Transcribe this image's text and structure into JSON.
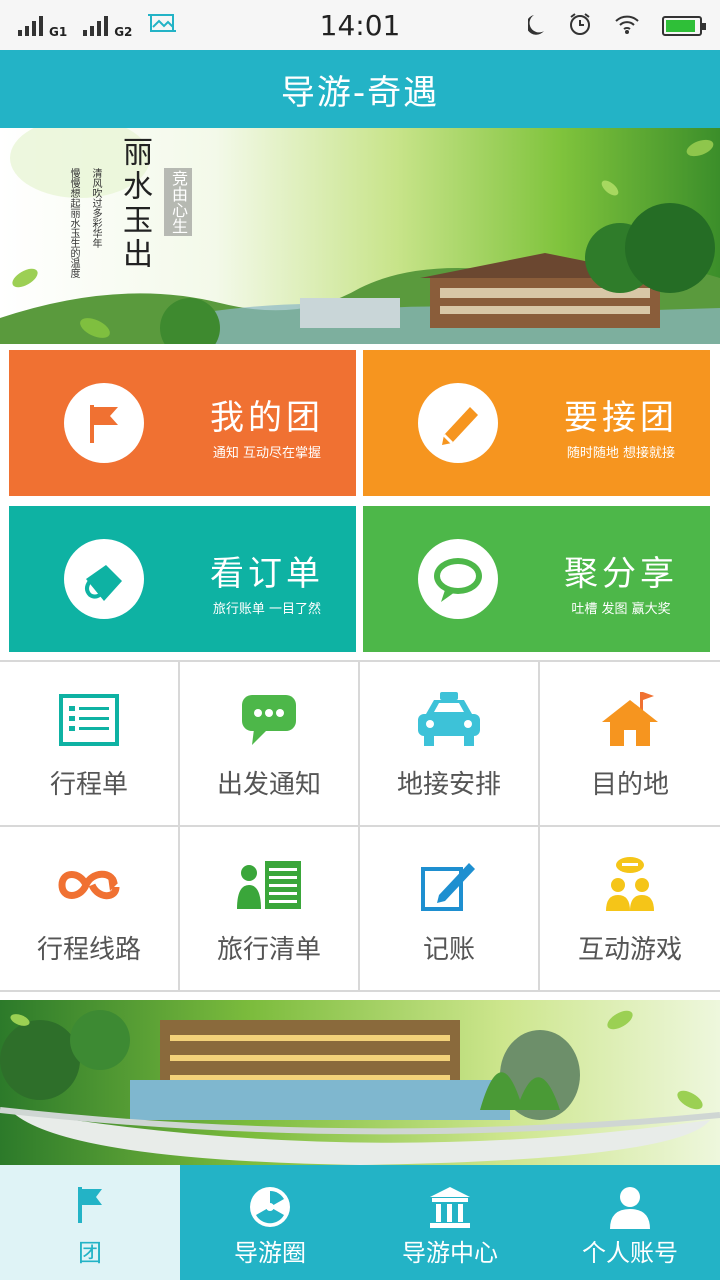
{
  "status_bar": {
    "sim1_label": "G1",
    "sim2_label": "G2",
    "time": "14:01"
  },
  "header": {
    "title": "导游-奇遇"
  },
  "banner_top": {
    "title": "丽水玉出",
    "tagline": "清风吹过多彩华年",
    "subline": "慢慢想起丽水玉生的温度",
    "stamp": "竞由心生"
  },
  "tiles": [
    {
      "title": "我的团",
      "subtitle": "通知 互动尽在掌握",
      "icon": "flag-icon",
      "color": "#f07132"
    },
    {
      "title": "要接团",
      "subtitle": "随时随地 想接就接",
      "icon": "pencil-icon",
      "color": "#f6951f"
    },
    {
      "title": "看订单",
      "subtitle": "旅行账单  一目了然",
      "icon": "clip-icon",
      "color": "#0eb2a3"
    },
    {
      "title": "聚分享",
      "subtitle": "吐槽 发图 赢大奖",
      "icon": "speech-bubble-icon",
      "color": "#4db749"
    }
  ],
  "grid": [
    {
      "label": "行程单",
      "icon": "itinerary-list-icon",
      "color": "#0eb2a3"
    },
    {
      "label": "出发通知",
      "icon": "chat-bubble-icon",
      "color": "#4db749"
    },
    {
      "label": "地接安排",
      "icon": "taxi-icon",
      "color": "#3dc2d8"
    },
    {
      "label": "目的地",
      "icon": "house-flag-icon",
      "color": "#f6951f"
    },
    {
      "label": "行程线路",
      "icon": "route-loop-icon",
      "color": "#f07132"
    },
    {
      "label": "旅行清单",
      "icon": "person-list-icon",
      "color": "#3aa63a"
    },
    {
      "label": "记账",
      "icon": "edit-note-icon",
      "color": "#1e8fd0"
    },
    {
      "label": "互动游戏",
      "icon": "people-chat-icon",
      "color": "#f5c518"
    }
  ],
  "tabbar": [
    {
      "label": "团",
      "icon": "flag-icon",
      "active": true
    },
    {
      "label": "导游圈",
      "icon": "radiation-icon",
      "active": false
    },
    {
      "label": "导游中心",
      "icon": "temple-icon",
      "active": false
    },
    {
      "label": "个人账号",
      "icon": "user-icon",
      "active": false
    }
  ],
  "colors": {
    "primary": "#23b3c6",
    "tab_active_bg": "#dff3f6"
  }
}
